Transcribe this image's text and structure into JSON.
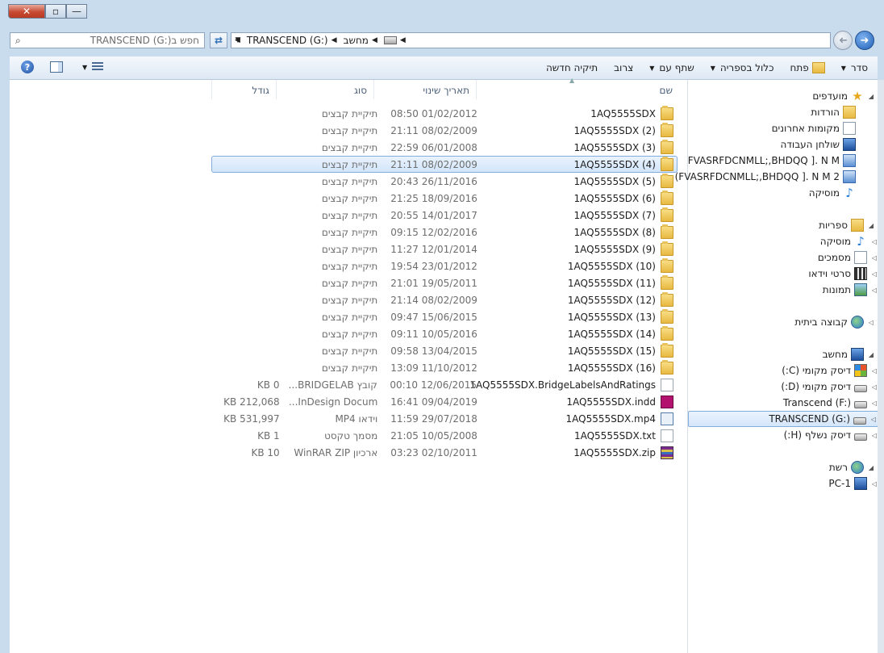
{
  "window": {
    "close_label": "✕",
    "max_label": "▫",
    "min_label": "—"
  },
  "address": {
    "crumbs": [
      "מחשב",
      "TRANSCEND (G:)"
    ],
    "search_placeholder": "חפש בTRANSCEND (G:)"
  },
  "toolbar": {
    "organize": "סדר",
    "open": "פתח",
    "include_library": "כלול בספריה",
    "share_with": "שתף עם",
    "burn": "צרוב",
    "new_folder": "תיקיה חדשה",
    "help": "?"
  },
  "columns": {
    "name": "שם",
    "date": "תאריך שינוי",
    "type": "סוג",
    "size": "גודל"
  },
  "files": [
    {
      "name": "1AQ5555SDX",
      "date": "01/02/2012 08:50",
      "type": "תיקיית קבצים",
      "size": "",
      "icon": "folder-icon"
    },
    {
      "name": "1AQ5555SDX (2)",
      "date": "08/02/2009 21:11",
      "type": "תיקיית קבצים",
      "size": "",
      "icon": "folder-icon"
    },
    {
      "name": "1AQ5555SDX (3)",
      "date": "06/01/2008 22:59",
      "type": "תיקיית קבצים",
      "size": "",
      "icon": "folder-icon"
    },
    {
      "name": "1AQ5555SDX (4)",
      "date": "08/02/2009 21:11",
      "type": "תיקיית קבצים",
      "size": "",
      "icon": "folder-icon",
      "selected": true
    },
    {
      "name": "1AQ5555SDX (5)",
      "date": "26/11/2016 20:43",
      "type": "תיקיית קבצים",
      "size": "",
      "icon": "folder-icon"
    },
    {
      "name": "1AQ5555SDX (6)",
      "date": "18/09/2016 21:25",
      "type": "תיקיית קבצים",
      "size": "",
      "icon": "folder-icon"
    },
    {
      "name": "1AQ5555SDX (7)",
      "date": "14/01/2017 20:55",
      "type": "תיקיית קבצים",
      "size": "",
      "icon": "folder-icon"
    },
    {
      "name": "1AQ5555SDX (8)",
      "date": "12/02/2016 09:15",
      "type": "תיקיית קבצים",
      "size": "",
      "icon": "folder-icon"
    },
    {
      "name": "1AQ5555SDX (9)",
      "date": "12/01/2014 11:27",
      "type": "תיקיית קבצים",
      "size": "",
      "icon": "folder-icon"
    },
    {
      "name": "1AQ5555SDX (10)",
      "date": "23/01/2012 19:54",
      "type": "תיקיית קבצים",
      "size": "",
      "icon": "folder-icon"
    },
    {
      "name": "1AQ5555SDX (11)",
      "date": "19/05/2011 21:01",
      "type": "תיקיית קבצים",
      "size": "",
      "icon": "folder-icon"
    },
    {
      "name": "1AQ5555SDX (12)",
      "date": "08/02/2009 21:14",
      "type": "תיקיית קבצים",
      "size": "",
      "icon": "folder-icon"
    },
    {
      "name": "1AQ5555SDX (13)",
      "date": "15/06/2015 09:47",
      "type": "תיקיית קבצים",
      "size": "",
      "icon": "folder-icon"
    },
    {
      "name": "1AQ5555SDX (14)",
      "date": "10/05/2016 09:11",
      "type": "תיקיית קבצים",
      "size": "",
      "icon": "folder-icon"
    },
    {
      "name": "1AQ5555SDX (15)",
      "date": "13/04/2015 09:58",
      "type": "תיקיית קבצים",
      "size": "",
      "icon": "folder-icon"
    },
    {
      "name": "1AQ5555SDX (16)",
      "date": "11/10/2012 13:09",
      "type": "תיקיית קבצים",
      "size": "",
      "icon": "folder-icon"
    },
    {
      "name": "1AQ5555SDX.BridgeLabelsAndRatings",
      "date": "12/06/2015 00:10",
      "type": "קובץ BRIDGELAB...",
      "size": "0 KB",
      "icon": "file-icon"
    },
    {
      "name": "1AQ5555SDX.indd",
      "date": "09/04/2019 16:41",
      "type": "InDesign Docum...",
      "size": "212,068 KB",
      "icon": "indesign-icon"
    },
    {
      "name": "1AQ5555SDX.mp4",
      "date": "29/07/2018 11:59",
      "type": "וידאו MP4",
      "size": "531,997 KB",
      "icon": "video-file-icon"
    },
    {
      "name": "1AQ5555SDX.txt",
      "date": "10/05/2008 21:05",
      "type": "מסמך טקסט",
      "size": "1 KB",
      "icon": "text-file-icon"
    },
    {
      "name": "1AQ5555SDX.zip",
      "date": "02/10/2011 03:23",
      "type": "ארכיון WinRAR ZIP",
      "size": "10 KB",
      "icon": "winrar-icon"
    }
  ],
  "navpane": {
    "favorites": {
      "label": "מועדפים",
      "items": [
        "הורדות",
        "מקומות אחרונים",
        "שולחן העבודה",
        "FVASRFDCNMLL;,BHDQQ ]. N M",
        "FVASRFDCNMLL;,BHDQQ ]. N M 2)"
      ]
    },
    "music_fav": "מוסיקה",
    "libraries": {
      "label": "ספריות",
      "items": [
        "מוסיקה",
        "מסמכים",
        "סרטי וידאו",
        "תמונות"
      ]
    },
    "homegroup": "קבוצה ביתית",
    "computer": {
      "label": "מחשב",
      "items": [
        "דיסק מקומי (C:)",
        "דיסק מקומי (D:)",
        "Transcend (F:)",
        "TRANSCEND (G:)",
        "דיסק נשלף (H:)"
      ]
    },
    "network": {
      "label": "רשת",
      "items": [
        "PC-1"
      ]
    }
  }
}
